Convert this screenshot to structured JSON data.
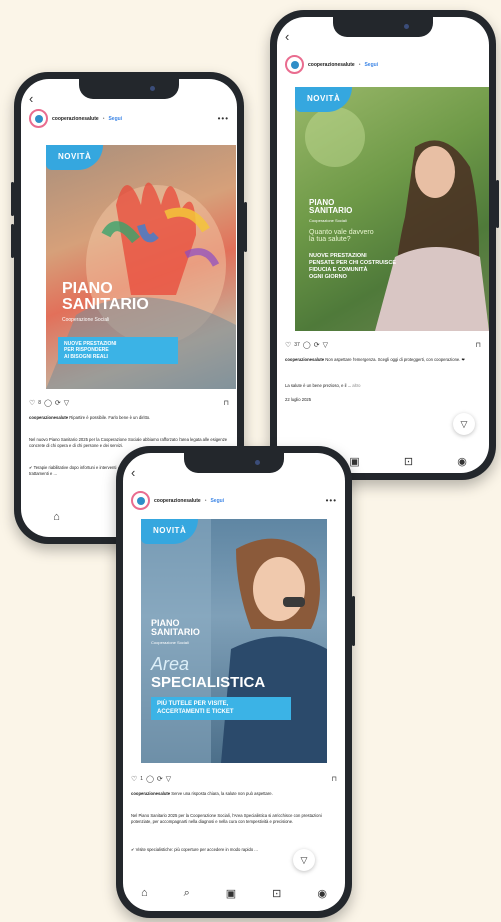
{
  "account": {
    "handle": "cooperazionesalute",
    "dot": "•",
    "follow": "Segui",
    "more": "•••"
  },
  "phones": {
    "left": {
      "badge": "NOVITÀ",
      "title_line1": "PIANO",
      "title_line2": "SANITARIO",
      "subtitle": "Cooperazione Sociali",
      "box_line1": "NUOVE PRESTAZIONI",
      "box_line2": "PER RISPONDERE",
      "box_line3": "AI BISOGNI REALI",
      "likes": "8",
      "caption_handle": "cooperazionesalute",
      "caption": "Ripartire è possibile. Farlo bene è un diritto.",
      "caption2": "Nel nuovo Piano Sanitario 2025 per la Cooperazione Sociale abbiamo rafforzato l'area legata alle esigenze concrete di chi opera e di chi persone e dei servizi.",
      "caption3": "✔ Terapie riabilitative dopo infortuni e interventi ✔ Nuove rimborsi previsti e nuovi servizi ✔ Logopedia, altri trattamenti e ..."
    },
    "right": {
      "badge": "NOVITÀ",
      "title_line1": "PIANO",
      "title_line2": "SANITARIO",
      "subtitle": "Cooperazione Sociali",
      "question": "Quanto vale davvero",
      "question2": "la tua salute?",
      "body_line1": "NUOVE PRESTAZIONI",
      "body_line2": "PENSATE PER CHI COSTRUISCE",
      "body_line3": "FIDUCIA E COMUNITÀ",
      "body_line4": "OGNI GIORNO",
      "likes": "37",
      "caption_handle": "cooperazionesalute",
      "caption": "Non aspettare l'emergenza. Scegli oggi di proteggerti, con cooperazione. ❤",
      "caption2": "La salute è un bene prezioso, e il ...",
      "caption_more": "altro",
      "date": "22 luglio 2025"
    },
    "front": {
      "badge": "NOVITÀ",
      "title_line1": "PIANO",
      "title_line2": "SANITARIO",
      "subtitle": "Cooperazione Sociali",
      "area": "Area",
      "specialistica": "SPECIALISTICA",
      "box_line1": "PIÙ TUTELE PER VISITE,",
      "box_line2": "ACCERTAMENTI E TICKET",
      "likes": "1",
      "caption_handle": "cooperazionesalute",
      "caption": "Serve una risposta chiara, la salute non può aspettare.",
      "caption2": "Nel Piano Sanitario 2025 per la Cooperazione Sociali, l'Area Specialistica si arricchisce con prestazioni potenziate, per accompagnarti nella diagnosi e nella cura con tempestività e precisione.",
      "caption3": "✔ Visite specialistiche: più coperture per accedere in modo rapido ..."
    }
  },
  "icons": {
    "back": "‹",
    "heart": "♡",
    "comment": "◯",
    "share": "⟳",
    "send": "▽",
    "save": "⊓",
    "home": "⌂",
    "search": "⌕",
    "reels": "▣",
    "shop": "⊡",
    "profile": "◉",
    "fab": "▽"
  },
  "colors": {
    "background": "#fbf5e8",
    "accent": "#35a7df",
    "phone": "#23272c"
  }
}
